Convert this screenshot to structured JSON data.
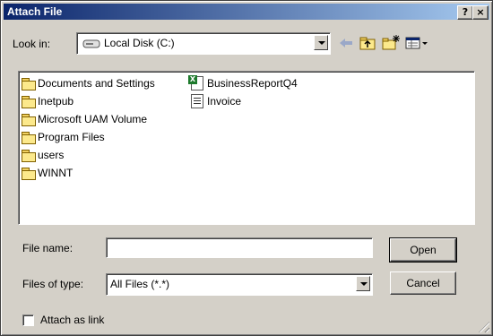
{
  "window": {
    "title": "Attach File",
    "help_label": "?",
    "close_label": "×"
  },
  "look_in": {
    "label": "Look in:",
    "value": "Local Disk (C:)"
  },
  "toolbar": {
    "icons": [
      "back-icon",
      "up-folder-icon",
      "new-folder-icon",
      "view-menu-icon"
    ]
  },
  "files": {
    "items": [
      {
        "name": "Documents and Settings",
        "icon": "folder-icon"
      },
      {
        "name": "Inetpub",
        "icon": "folder-icon"
      },
      {
        "name": "Microsoft UAM Volume",
        "icon": "folder-icon"
      },
      {
        "name": "Program Files",
        "icon": "folder-icon"
      },
      {
        "name": "users",
        "icon": "folder-icon"
      },
      {
        "name": "WINNT",
        "icon": "folder-icon"
      },
      {
        "name": "BusinessReportQ4",
        "icon": "excel-file-icon"
      },
      {
        "name": "Invoice",
        "icon": "text-file-icon"
      }
    ]
  },
  "file_name": {
    "label": "File name:",
    "value": ""
  },
  "file_type": {
    "label": "Files of type:",
    "value": "All Files (*.*)"
  },
  "buttons": {
    "open": "Open",
    "cancel": "Cancel"
  },
  "attach_link": {
    "label": "Attach as link",
    "checked": false
  },
  "colors": {
    "title_start": "#0a246a",
    "title_end": "#a6caf0",
    "face": "#d4d0c8"
  }
}
